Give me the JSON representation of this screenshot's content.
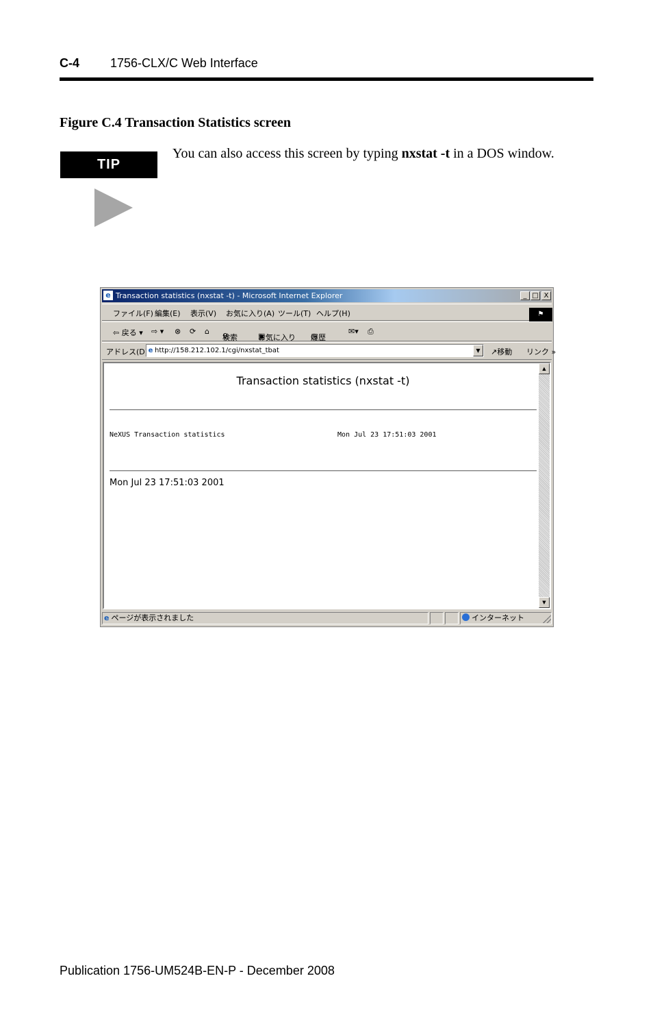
{
  "header": {
    "section_number": "C-4",
    "section_title": "1756-CLX/C Web Interface"
  },
  "figure": {
    "caption": "Figure C.4 Transaction Statistics screen"
  },
  "tip": {
    "label": "TIP",
    "text_before": "You can also access this screen by typing ",
    "command": "nxstat -t",
    "text_after": " in a DOS window."
  },
  "browser": {
    "title": "Transaction statistics (nxstat -t) - Microsoft Internet Explorer",
    "window_buttons": {
      "minimize": "_",
      "maximize": "□",
      "close": "X"
    },
    "menu": [
      "ファイル(F)",
      "編集(E)",
      "表示(V)",
      "お気に入り(A)",
      "ツール(T)",
      "ヘルプ(H)"
    ],
    "toolbar": {
      "back": "⇦ 戻る ▾",
      "forward": "⇨ ▾",
      "stop": "⊗",
      "refresh": "⟳",
      "home": "⌂",
      "search": "検索",
      "favorites": "お気に入り",
      "history": "履歴",
      "mail": "✉▾",
      "print": "⎙"
    },
    "address": {
      "label": "アドレス(D)",
      "url": "http://158.212.102.1/cgi/nxstat_tbat",
      "go": "移動",
      "links": "リンク »"
    },
    "page": {
      "heading": "Transaction statistics (nxstat -t)",
      "mono_left": "NeXUS Transaction statistics",
      "mono_right": "Mon Jul 23 17:51:03 2001",
      "plain_timestamp": "Mon Jul 23 17:51:03 2001"
    },
    "status": {
      "text": "ページが表示されました",
      "zone": "インターネット"
    }
  },
  "footer": {
    "publication": "Publication 1756-UM524B-EN-P - December 2008"
  }
}
